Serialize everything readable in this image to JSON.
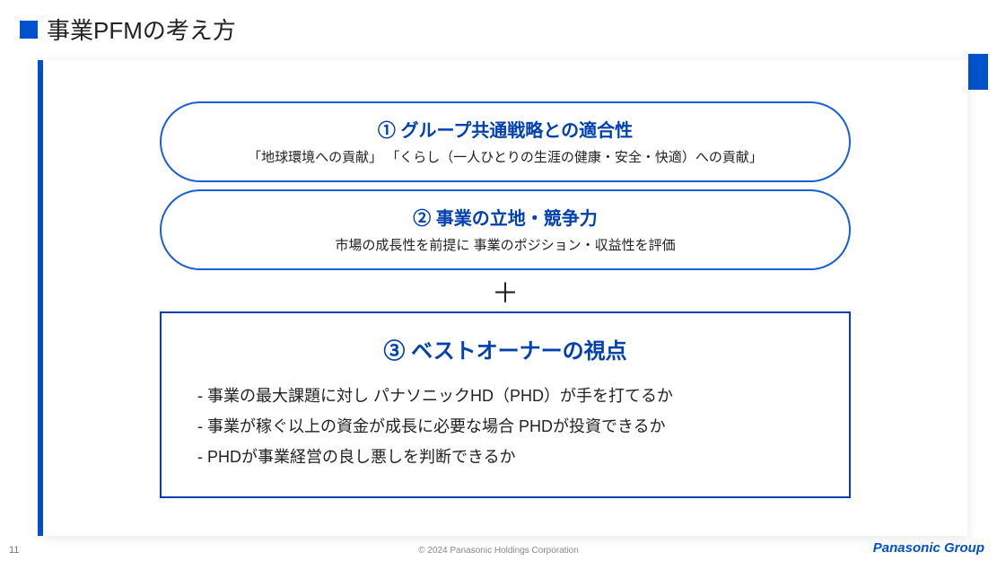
{
  "title": "事業PFMの考え方",
  "block1": {
    "heading": "① グループ共通戦略との適合性",
    "sub": "「地球環境への貢献」 「くらし（一人ひとりの生涯の健康・安全・快適）への貢献」"
  },
  "block2": {
    "heading": "② 事業の立地・競争力",
    "sub": "市場の成長性を前提に 事業のポジション・収益性を評価"
  },
  "plus": "＋",
  "block3": {
    "heading": "③ ベストオーナーの視点",
    "items": [
      "事業の最大課題に対し パナソニックHD（PHD）が手を打てるか",
      "事業が稼ぐ以上の資金が成長に必要な場合 PHDが投資できるか",
      "PHDが事業経営の良し悪しを判断できるか"
    ]
  },
  "page_number": "11",
  "copyright": "© 2024 Panasonic Holdings Corporation",
  "brand": "Panasonic Group"
}
